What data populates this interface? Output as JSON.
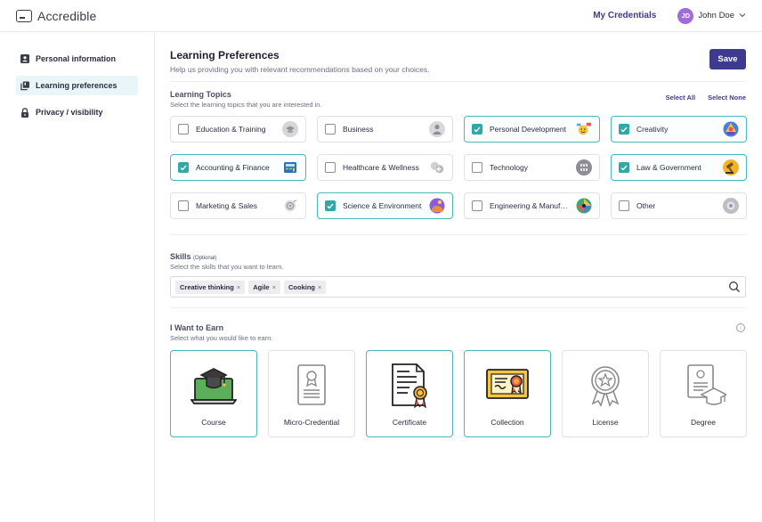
{
  "header": {
    "brand": "Accredible",
    "my_credentials": "My Credentials",
    "user_initials": "JD",
    "user_name": "John Doe",
    "accent": "#3d3a8f"
  },
  "sidebar": {
    "items": [
      {
        "label": "Personal information",
        "icon": "person-card-icon",
        "active": false
      },
      {
        "label": "Learning preferences",
        "icon": "book-stack-icon",
        "active": true
      },
      {
        "label": "Privacy / visibility",
        "icon": "lock-icon",
        "active": false
      }
    ]
  },
  "main": {
    "title": "Learning Preferences",
    "subtitle": "Help us providing you with relevant recommendations based on your choices.",
    "save_label": "Save",
    "topics": {
      "title": "Learning Topics",
      "subtitle": "Select the learning topics that you are interested in.",
      "select_all": "Select All",
      "select_none": "Select None",
      "items": [
        {
          "label": "Education & Training",
          "checked": false,
          "icon": "education-icon"
        },
        {
          "label": "Business",
          "checked": false,
          "icon": "business-icon"
        },
        {
          "label": "Personal Development",
          "checked": true,
          "icon": "personal-development-icon"
        },
        {
          "label": "Creativity",
          "checked": true,
          "icon": "creativity-icon"
        },
        {
          "label": "Accounting & Finance",
          "checked": true,
          "icon": "finance-icon"
        },
        {
          "label": "Healthcare & Wellness",
          "checked": false,
          "icon": "healthcare-icon"
        },
        {
          "label": "Technology",
          "checked": false,
          "icon": "technology-icon"
        },
        {
          "label": "Law & Government",
          "checked": true,
          "icon": "law-icon"
        },
        {
          "label": "Marketing & Sales",
          "checked": false,
          "icon": "marketing-icon"
        },
        {
          "label": "Science & Environment",
          "checked": true,
          "icon": "science-icon"
        },
        {
          "label": "Engineering & Manufacturing",
          "checked": false,
          "icon": "engineering-icon"
        },
        {
          "label": "Other",
          "checked": false,
          "icon": "other-icon"
        }
      ]
    },
    "skills": {
      "title": "Skills",
      "optional": "(Optional)",
      "subtitle": "Select the skills that you want to learn.",
      "chips": [
        "Creative thinking",
        "Agile",
        "Cooking"
      ],
      "remove_glyph": "×"
    },
    "earn": {
      "title": "I Want to Earn",
      "subtitle": "Select what you would like to earn.",
      "info_glyph": "i",
      "items": [
        {
          "label": "Course",
          "selected": true,
          "icon": "laptop-graduation-icon"
        },
        {
          "label": "Micro-Credential",
          "selected": false,
          "icon": "micro-credential-icon"
        },
        {
          "label": "Certificate",
          "selected": true,
          "icon": "certificate-icon"
        },
        {
          "label": "Collection",
          "selected": true,
          "icon": "collection-icon"
        },
        {
          "label": "License",
          "selected": false,
          "icon": "license-badge-icon"
        },
        {
          "label": "Degree",
          "selected": false,
          "icon": "degree-icon"
        }
      ]
    }
  }
}
